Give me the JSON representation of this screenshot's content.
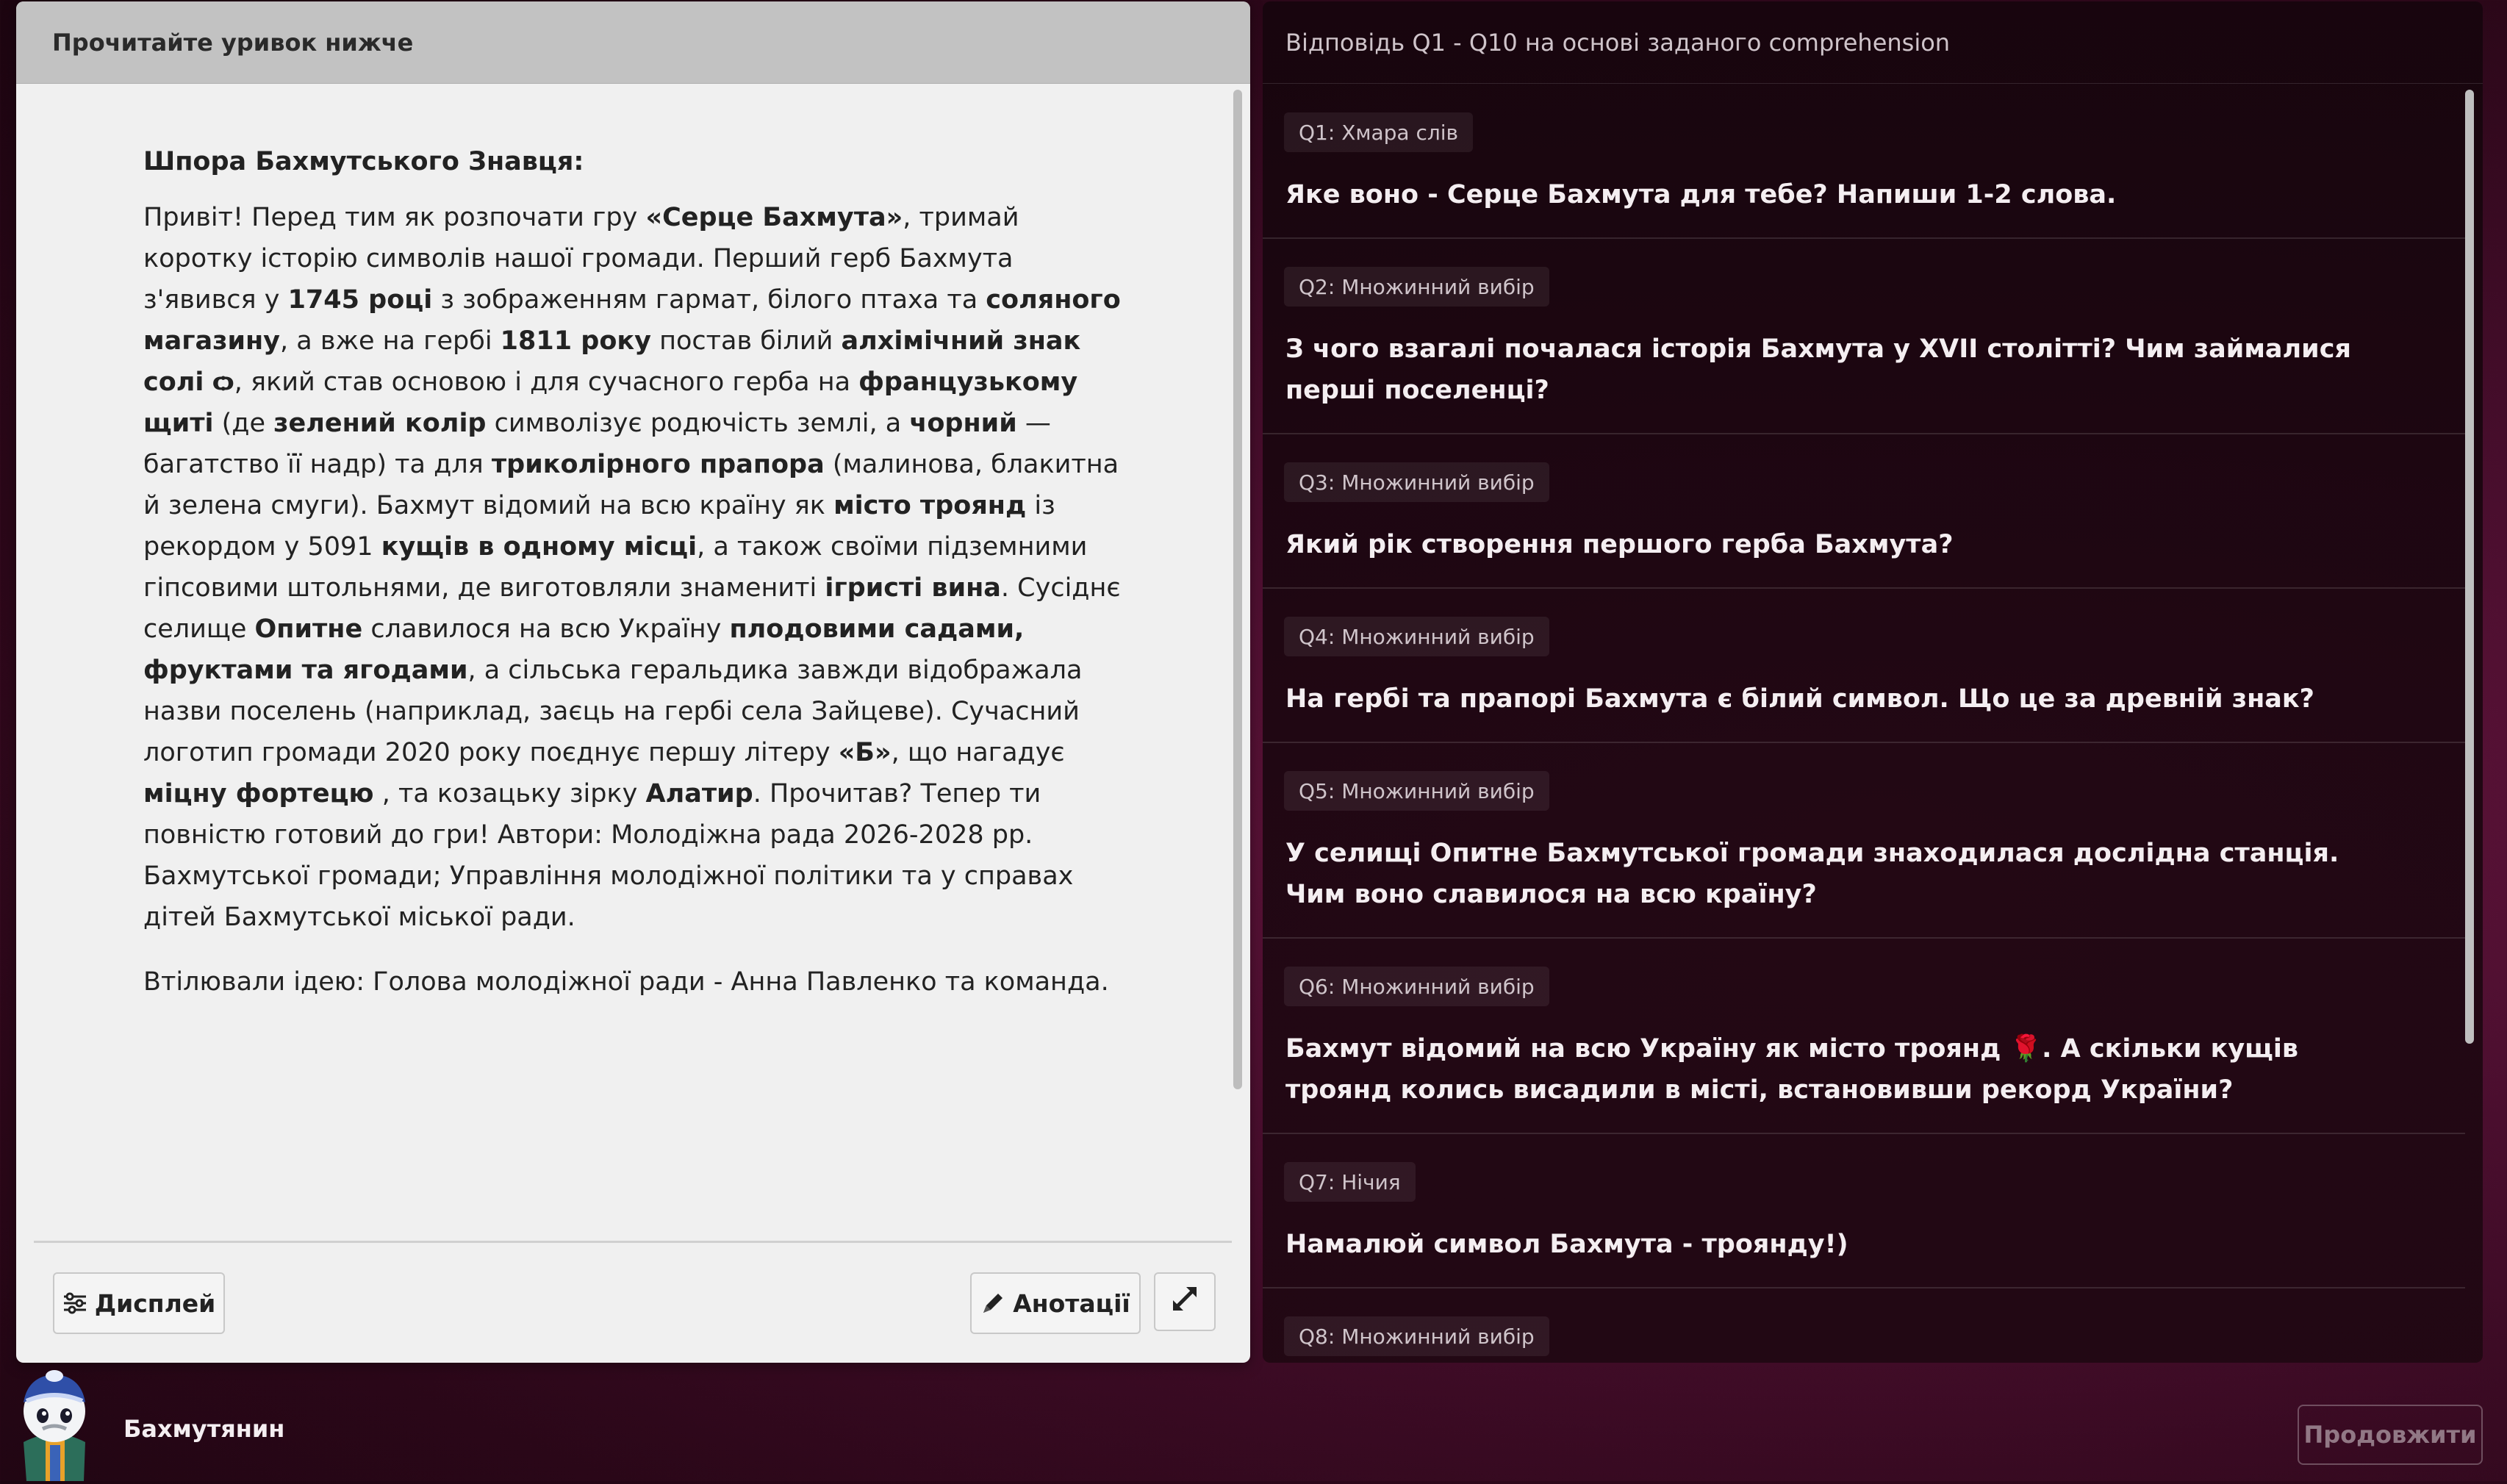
{
  "left_panel": {
    "header": "Прочитайте уривок нижче",
    "passage_title": "Шпора Бахмутського Знавця:",
    "passage_parts": [
      {
        "t": "Привіт! Перед тим як розпочати гру "
      },
      {
        "t": "«Серце Бахмута»",
        "b": true
      },
      {
        "t": ", тримай коротку історію символів нашої громади. Перший герб Бахмута з'явився у "
      },
      {
        "t": "1745 році",
        "b": true
      },
      {
        "t": " з зображенням гармат, білого птаха та "
      },
      {
        "t": "соляного магазину",
        "b": true
      },
      {
        "t": ", а вже на гербі "
      },
      {
        "t": "1811 року",
        "b": true
      },
      {
        "t": " постав білий "
      },
      {
        "t": "алхімічний знак солі",
        "b": true
      },
      {
        "t": " "
      },
      {
        "t": "ѻ",
        "b": true
      },
      {
        "t": ", який став основою і для сучасного герба на "
      },
      {
        "t": "французькому щиті",
        "b": true
      },
      {
        "t": " (де "
      },
      {
        "t": "зелений колір",
        "b": true
      },
      {
        "t": " символізує родючість землі, а "
      },
      {
        "t": "чорний",
        "b": true
      },
      {
        "t": " — багатство її надр) та для "
      },
      {
        "t": "триколірного прапора",
        "b": true
      },
      {
        "t": " (малинова, блакитна й зелена смуги). Бахмут відомий на всю країну як "
      },
      {
        "t": "місто троянд",
        "b": true
      },
      {
        "t": " із рекордом у 5091 "
      },
      {
        "t": "кущів в одному місці",
        "b": true
      },
      {
        "t": ", а також своїми підземними гіпсовими штольнями, де виготовляли знамениті "
      },
      {
        "t": "ігристі вина",
        "b": true
      },
      {
        "t": ". Сусіднє селище "
      },
      {
        "t": "Опитне",
        "b": true
      },
      {
        "t": " славилося на всю Україну "
      },
      {
        "t": "плодовими садами, фруктами та ягодами",
        "b": true
      },
      {
        "t": ", а сільська геральдика завжди відображала назви поселень (наприклад, заєць на гербі села Зайцеве). Сучасний логотип громади 2020 року поєднує першу літеру "
      },
      {
        "t": "«Б»",
        "b": true
      },
      {
        "t": ", що нагадує "
      },
      {
        "t": "міцну фортецю",
        "b": true
      },
      {
        "t": " , та козацьку зірку "
      },
      {
        "t": "Алатир",
        "b": true
      },
      {
        "t": ". Прочитав? Тепер ти повністю готовий до гри! Автори: Молодіжна рада 2026-2028 рр. Бахмутської громади; Управління молодіжної політики та у справах дітей Бахмутської міської ради."
      }
    ],
    "passage_footer": "Втілювали ідею: Голова молодіжної ради - Анна Павленко та команда.",
    "display_button": "Дисплей",
    "annotations_button": "Анотації"
  },
  "right_panel": {
    "header": "Відповідь Q1 - Q10 на основі заданого comprehension",
    "questions": [
      {
        "tag": "Q1: Хмара слів",
        "text": "Яке воно - Серце Бахмута для тебе? Напиши 1-2 слова."
      },
      {
        "tag": "Q2: Множинний вибір",
        "text": "З чого взагалі почалася історія Бахмута у XVII столітті? Чим займалися перші поселенці?"
      },
      {
        "tag": "Q3: Множинний вибір",
        "text": "Який рік створення першого герба Бахмута?"
      },
      {
        "tag": "Q4: Множинний вибір",
        "text": "На гербі та прапорі Бахмута є білий символ. Що це за древній знак?"
      },
      {
        "tag": "Q5: Множинний вибір",
        "text": "У селищі Опитне Бахмутської громади знаходилася дослідна станція. Чим воно славилося на всю країну?"
      },
      {
        "tag": "Q6: Множинний вибір",
        "text": "Бахмут відомий на всю Україну як місто троянд 🌹. А скільки кущів троянд колись висадили в місті, встановивши рекорд України?"
      },
      {
        "tag": "Q7: Нічия",
        "text": "Намалюй символ Бахмута - троянду!)"
      },
      {
        "tag": "Q8: Множинний вибір",
        "text": ""
      }
    ]
  },
  "bottom_bar": {
    "username": "Бахмутянин",
    "continue_button": "Продовжити"
  },
  "colors": {
    "background": "#4a0e2e",
    "left_panel": "#f0f0f0",
    "left_header": "#c2c2c2",
    "right_panel": "#1e0711"
  }
}
